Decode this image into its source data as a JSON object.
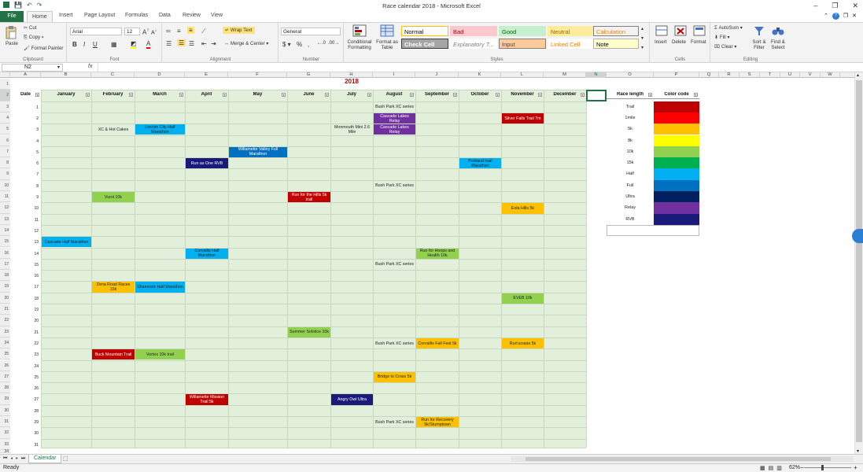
{
  "titlebar": {
    "title": "Race calendar 2018  -  Microsoft Excel"
  },
  "tabs": {
    "file": "File",
    "items": [
      "Home",
      "Insert",
      "Page Layout",
      "Formulas",
      "Data",
      "Review",
      "View"
    ]
  },
  "ribbon": {
    "clipboard": {
      "paste": "Paste",
      "cut": "Cut",
      "copy": "Copy",
      "format_painter": "Format Painter",
      "label": "Clipboard"
    },
    "font": {
      "name": "Arial",
      "size": "12",
      "label": "Font"
    },
    "alignment": {
      "wrap": "Wrap Text",
      "merge": "Merge & Center",
      "label": "Alignment"
    },
    "number": {
      "format": "General",
      "label": "Number"
    },
    "styles": {
      "cond": "Conditional Formatting",
      "table": "Format as Table",
      "label": "Styles",
      "cells": [
        {
          "text": "Normal",
          "bg": "#ffffff",
          "color": "#000000",
          "border": "#ffc000"
        },
        {
          "text": "Bad",
          "bg": "#ffc7ce",
          "color": "#9c0006",
          "border": "#ffc7ce"
        },
        {
          "text": "Good",
          "bg": "#c6efce",
          "color": "#006100",
          "border": "#c6efce"
        },
        {
          "text": "Neutral",
          "bg": "#ffeb9c",
          "color": "#9c6500",
          "border": "#ffeb9c"
        },
        {
          "text": "Calculation",
          "bg": "#f2f2f2",
          "color": "#fa7d00",
          "border": "#7f7f7f"
        },
        {
          "text": "Check Cell",
          "bg": "#a5a5a5",
          "color": "#ffffff",
          "border": "#3f3f3f"
        },
        {
          "text": "Explanatory T...",
          "bg": "#ffffff",
          "color": "#7f7f7f",
          "border": "#ffffff"
        },
        {
          "text": "Input",
          "bg": "#ffcc99",
          "color": "#3f3f76",
          "border": "#7f7f7f"
        },
        {
          "text": "Linked Cell",
          "bg": "#ffffff",
          "color": "#fa7d00",
          "border": "#ffffff"
        },
        {
          "text": "Note",
          "bg": "#ffffcc",
          "color": "#000000",
          "border": "#b2b2b2"
        }
      ]
    },
    "cells": {
      "insert": "Insert",
      "delete": "Delete",
      "format": "Format",
      "label": "Cells"
    },
    "editing": {
      "autosum": "AutoSum",
      "fill": "Fill",
      "clear": "Clear",
      "sort": "Sort & Filter",
      "find": "Find & Select",
      "label": "Editing"
    }
  },
  "formula_bar": {
    "namebox": "N2",
    "fx": "fx",
    "value": ""
  },
  "sheet": {
    "col_letters": [
      "A",
      "B",
      "C",
      "D",
      "E",
      "F",
      "G",
      "H",
      "I",
      "J",
      "K",
      "L",
      "M",
      "N",
      "O",
      "P",
      "Q",
      "R",
      "S",
      "T",
      "U",
      "V",
      "W"
    ],
    "title_cell": "2018",
    "headers": [
      "Date",
      "January",
      "February",
      "March",
      "April",
      "May",
      "June",
      "July",
      "August",
      "September",
      "October",
      "November",
      "December"
    ],
    "row_numbers": [
      "1",
      "2",
      "3",
      "4",
      "5",
      "6",
      "7",
      "8",
      "9",
      "10",
      "11",
      "12",
      "13",
      "14",
      "15",
      "16",
      "17",
      "18",
      "19",
      "20",
      "21",
      "22",
      "23",
      "24",
      "25",
      "26",
      "27",
      "28",
      "29",
      "30",
      "31",
      "32",
      "33",
      "34",
      "35"
    ],
    "days": [
      "1",
      "2",
      "3",
      "4",
      "5",
      "6",
      "7",
      "8",
      "9",
      "10",
      "11",
      "12",
      "13",
      "14",
      "15",
      "16",
      "17",
      "18",
      "19",
      "20",
      "21",
      "22",
      "23",
      "24",
      "25",
      "26",
      "27",
      "28",
      "29",
      "30",
      "31"
    ],
    "races": [
      {
        "day": 1,
        "month": 8,
        "text": "Bush Park XC series",
        "bg": "#e2efda",
        "color": "#222222"
      },
      {
        "day": 2,
        "month": 8,
        "text": "Cascade Lakes Relay",
        "bg": "#7030a0",
        "color": "#ffffff"
      },
      {
        "day": 2,
        "month": 11,
        "text": "Silver Falls Trail 7m",
        "bg": "#c00000",
        "color": "#ffffff"
      },
      {
        "day": 3,
        "month": 2,
        "text": "XC & Hot Cakes",
        "bg": "#e2efda",
        "color": "#222222"
      },
      {
        "day": 3,
        "month": 3,
        "text": "Lincoln City Half Marathon",
        "bg": "#00b0f0",
        "color": "#222222"
      },
      {
        "day": 3,
        "month": 7,
        "text": "Monmouth Mini 2.6 Mile",
        "bg": "#e2efda",
        "color": "#222222"
      },
      {
        "day": 3,
        "month": 8,
        "text": "Cascade Lakes Relay",
        "bg": "#7030a0",
        "color": "#ffffff"
      },
      {
        "day": 5,
        "month": 5,
        "text": "Willamette Valley Full Marathon",
        "bg": "#0070c0",
        "color": "#ffffff"
      },
      {
        "day": 6,
        "month": 4,
        "text": "Run as One RVB",
        "bg": "#1a1a7a",
        "color": "#ffffff"
      },
      {
        "day": 6,
        "month": 10,
        "text": "Portland Half Marathon",
        "bg": "#00b0f0",
        "color": "#222222"
      },
      {
        "day": 8,
        "month": 8,
        "text": "Bush Park XC series",
        "bg": "#e2efda",
        "color": "#222222"
      },
      {
        "day": 9,
        "month": 2,
        "text": "Vurst 10k",
        "bg": "#92d050",
        "color": "#222222"
      },
      {
        "day": 9,
        "month": 6,
        "text": "Run for the Hills 5k trail",
        "bg": "#c00000",
        "color": "#ffffff"
      },
      {
        "day": 10,
        "month": 11,
        "text": "Eola Hills 5k",
        "bg": "#ffc000",
        "color": "#222222"
      },
      {
        "day": 13,
        "month": 1,
        "text": "Cascade Half Marathon",
        "bg": "#00b0f0",
        "color": "#222222"
      },
      {
        "day": 14,
        "month": 4,
        "text": "Corvallis Half Marathon",
        "bg": "#00b0f0",
        "color": "#222222"
      },
      {
        "day": 14,
        "month": 9,
        "text": "Run for Hoops and Health 10k",
        "bg": "#92d050",
        "color": "#222222"
      },
      {
        "day": 15,
        "month": 8,
        "text": "Bush Park XC series",
        "bg": "#e2efda",
        "color": "#222222"
      },
      {
        "day": 17,
        "month": 2,
        "text": "Zena Road Races 15k",
        "bg": "#ffc000",
        "color": "#222222"
      },
      {
        "day": 17,
        "month": 3,
        "text": "Shamrock Half Marathon",
        "bg": "#00b0f0",
        "color": "#222222"
      },
      {
        "day": 18,
        "month": 11,
        "text": "EVEB 10k",
        "bg": "#92d050",
        "color": "#222222"
      },
      {
        "day": 21,
        "month": 6,
        "text": "Summer Solstice 10k",
        "bg": "#92d050",
        "color": "#222222"
      },
      {
        "day": 22,
        "month": 8,
        "text": "Bush Park XC series",
        "bg": "#e2efda",
        "color": "#222222"
      },
      {
        "day": 22,
        "month": 9,
        "text": "Corvallis Fall Fest 5k",
        "bg": "#ffc000",
        "color": "#222222"
      },
      {
        "day": 22,
        "month": 11,
        "text": "Run'ucopia 5k",
        "bg": "#ffc000",
        "color": "#222222"
      },
      {
        "day": 23,
        "month": 2,
        "text": "Buck Mountain Trail",
        "bg": "#c00000",
        "color": "#ffffff"
      },
      {
        "day": 23,
        "month": 3,
        "text": "Vortex 10k trail",
        "bg": "#92d050",
        "color": "#222222"
      },
      {
        "day": 25,
        "month": 8,
        "text": "Bridge to Cross 5k",
        "bg": "#ffc000",
        "color": "#222222"
      },
      {
        "day": 27,
        "month": 4,
        "text": "Willamette Mission Trail 5k",
        "bg": "#c00000",
        "color": "#ffffff"
      },
      {
        "day": 27,
        "month": 7,
        "text": "Angry Owl Ultra",
        "bg": "#1a1a7a",
        "color": "#ffffff"
      },
      {
        "day": 29,
        "month": 8,
        "text": "Bush Park XC series",
        "bg": "#e2efda",
        "color": "#222222"
      },
      {
        "day": 29,
        "month": 9,
        "text": "Run for Recovery 5k/Stumptown",
        "bg": "#ffc000",
        "color": "#222222"
      }
    ],
    "legend": {
      "header_length": "Race length",
      "header_color": "Color code",
      "items": [
        {
          "label": "Trail",
          "color": "#c00000"
        },
        {
          "label": "1mile",
          "color": "#ff0000"
        },
        {
          "label": "5k",
          "color": "#ffc000"
        },
        {
          "label": "8k",
          "color": "#ffff00"
        },
        {
          "label": "10k",
          "color": "#92d050"
        },
        {
          "label": "15k",
          "color": "#00b050"
        },
        {
          "label": "Half",
          "color": "#00b0f0"
        },
        {
          "label": "Full",
          "color": "#0070c0"
        },
        {
          "label": "Ultra",
          "color": "#002060"
        },
        {
          "label": "Relay",
          "color": "#7030a0"
        },
        {
          "label": "RVB",
          "color": "#1a1a7a"
        }
      ]
    }
  },
  "sheet_tabs": {
    "active": "Calendar"
  },
  "status": {
    "ready": "Ready",
    "zoom": "62%"
  }
}
